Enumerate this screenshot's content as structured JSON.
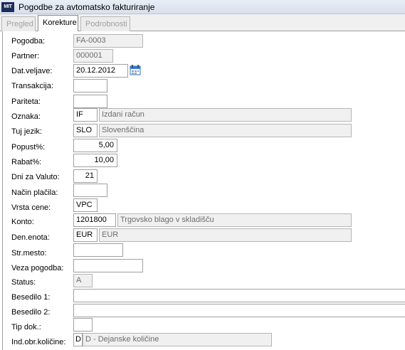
{
  "window": {
    "title": "Pogodbe za avtomatsko fakturiranje",
    "icon_text": "MIT",
    "icon": "app-logo-icon"
  },
  "tabs": [
    {
      "label": "Pregled",
      "active": false
    },
    {
      "label": "Korekture",
      "active": true
    },
    {
      "label": "Podrobnosti",
      "active": false
    }
  ],
  "form": {
    "pogodba": {
      "label": "Pogodba:",
      "value": "FA-0003"
    },
    "partner": {
      "label": "Partner:",
      "value": "000001"
    },
    "dat_veljave": {
      "label": "Dat.veljave:",
      "value": "20.12.2012",
      "icon": "calendar-icon"
    },
    "transakcija": {
      "label": "Transakcija:",
      "value": ""
    },
    "pariteta": {
      "label": "Pariteta:",
      "value": ""
    },
    "oznaka": {
      "label": "Oznaka:",
      "code": "IF",
      "description": "Izdani račun"
    },
    "tuj_jezik": {
      "label": "Tuj jezik:",
      "code": "SLO",
      "description": "Slovenščina"
    },
    "popust": {
      "label": "Popust%:",
      "value": "5,00"
    },
    "rabat": {
      "label": "Rabat%:",
      "value": "10,00"
    },
    "dni_za_valuto": {
      "label": "Dni za Valuto:",
      "value": "21"
    },
    "nacin_placila": {
      "label": "Način plačila:",
      "value": ""
    },
    "vrsta_cene": {
      "label": "Vrsta cene:",
      "value": "VPC"
    },
    "konto": {
      "label": "Konto:",
      "code": "1201800",
      "description": "Trgovsko blago v skladišču"
    },
    "den_enota": {
      "label": "Den.enota:",
      "code": "EUR",
      "description": "EUR"
    },
    "str_mesto": {
      "label": "Str.mesto:",
      "value": ""
    },
    "veza_pogodba": {
      "label": "Veza pogodba:",
      "value": ""
    },
    "status": {
      "label": "Status:",
      "value": "A"
    },
    "besedilo1": {
      "label": "Besedilo 1:",
      "value": ""
    },
    "besedilo2": {
      "label": "Besedilo 2:",
      "value": ""
    },
    "tip_dok": {
      "label": "Tip dok.:",
      "value": ""
    },
    "ind_obr_kolicine": {
      "label": "Ind.obr.količine:",
      "code": "D",
      "description": "D - Dejanske količine"
    }
  }
}
